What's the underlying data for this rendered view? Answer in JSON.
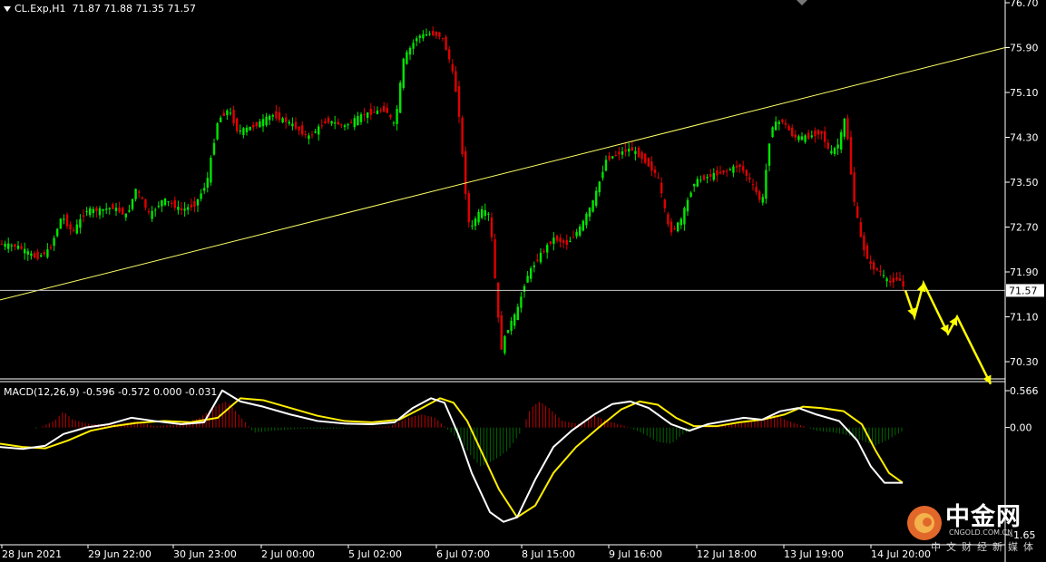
{
  "header": {
    "symbol": "CL.Exp,H1",
    "ohlc": "71.87 71.88 71.35 71.57",
    "macd_label": "MACD(12,26,9) -0.596 -0.572 0.000 -0.031"
  },
  "watermark": {
    "name": "中金网",
    "url": "CNGOLD.COM.CN",
    "tagline": "中文财经新媒体"
  },
  "colors": {
    "bull": "#00e600",
    "bear": "#e00000",
    "trendline": "#ffff66",
    "arrow": "#ffff00",
    "macd_line": "#ffffff",
    "signal_line": "#ffee00",
    "hist_pos": "#c00000",
    "hist_neg": "#006600"
  },
  "chart_data": [
    {
      "type": "candlestick",
      "timeframe": "H1",
      "y_ticks": [
        "76.70",
        "75.90",
        "75.10",
        "74.30",
        "73.50",
        "72.70",
        "71.90",
        "71.10",
        "70.30"
      ],
      "ylim": [
        70.0,
        76.7
      ],
      "current_price": "71.57",
      "x_ticks": [
        "28 Jun 2021",
        "29 Jun 22:00",
        "30 Jun 23:00",
        "2 Jul 00:00",
        "5 Jul 02:00",
        "6 Jul 07:00",
        "8 Jul 15:00",
        "9 Jul 16:00",
        "12 Jul 18:00",
        "13 Jul 19:00",
        "14 Jul 20:00"
      ],
      "close_path": [
        [
          0,
          72.4
        ],
        [
          20,
          72.35
        ],
        [
          40,
          72.15
        ],
        [
          55,
          72.3
        ],
        [
          68,
          72.9
        ],
        [
          80,
          72.6
        ],
        [
          95,
          73.0
        ],
        [
          110,
          73.0
        ],
        [
          125,
          73.05
        ],
        [
          140,
          72.9
        ],
        [
          150,
          73.4
        ],
        [
          165,
          72.9
        ],
        [
          180,
          73.2
        ],
        [
          200,
          73.0
        ],
        [
          215,
          73.1
        ],
        [
          228,
          73.5
        ],
        [
          240,
          74.6
        ],
        [
          252,
          74.8
        ],
        [
          262,
          74.4
        ],
        [
          280,
          74.5
        ],
        [
          300,
          74.7
        ],
        [
          320,
          74.55
        ],
        [
          340,
          74.3
        ],
        [
          360,
          74.6
        ],
        [
          380,
          74.5
        ],
        [
          400,
          74.7
        ],
        [
          425,
          74.8
        ],
        [
          435,
          74.5
        ],
        [
          445,
          75.7
        ],
        [
          460,
          76.1
        ],
        [
          475,
          76.15
        ],
        [
          487,
          76.1
        ],
        [
          497,
          75.6
        ],
        [
          505,
          74.9
        ],
        [
          512,
          73.5
        ],
        [
          518,
          72.6
        ],
        [
          525,
          72.9
        ],
        [
          532,
          73.0
        ],
        [
          540,
          72.9
        ],
        [
          547,
          71.5
        ],
        [
          552,
          70.5
        ],
        [
          560,
          70.9
        ],
        [
          570,
          71.2
        ],
        [
          580,
          71.8
        ],
        [
          595,
          72.2
        ],
        [
          610,
          72.5
        ],
        [
          625,
          72.4
        ],
        [
          640,
          72.7
        ],
        [
          655,
          73.2
        ],
        [
          668,
          73.9
        ],
        [
          680,
          74.0
        ],
        [
          695,
          74.1
        ],
        [
          710,
          73.9
        ],
        [
          725,
          73.6
        ],
        [
          738,
          72.6
        ],
        [
          750,
          72.8
        ],
        [
          765,
          73.5
        ],
        [
          780,
          73.6
        ],
        [
          800,
          73.7
        ],
        [
          815,
          73.8
        ],
        [
          828,
          73.5
        ],
        [
          840,
          73.1
        ],
        [
          850,
          74.5
        ],
        [
          862,
          74.6
        ],
        [
          875,
          74.3
        ],
        [
          890,
          74.3
        ],
        [
          905,
          74.4
        ],
        [
          915,
          74.0
        ],
        [
          925,
          74.2
        ],
        [
          932,
          74.7
        ],
        [
          940,
          73.3
        ],
        [
          950,
          72.4
        ],
        [
          960,
          72.0
        ],
        [
          970,
          71.9
        ],
        [
          980,
          71.7
        ],
        [
          990,
          71.8
        ],
        [
          998,
          71.57
        ]
      ],
      "trendline": {
        "from": [
          0,
          71.4
        ],
        "to": [
          1108,
          75.9
        ]
      },
      "horizontal_line": 71.57,
      "forecast_arrow": [
        [
          998,
          71.57
        ],
        [
          1008,
          71.1
        ],
        [
          1018,
          71.7
        ],
        [
          1045,
          70.8
        ],
        [
          1055,
          71.1
        ],
        [
          1092,
          69.9
        ]
      ]
    },
    {
      "type": "macd",
      "params": "12,26,9",
      "y_ticks": [
        "0.566",
        "0.00",
        "-1.65"
      ],
      "ylim": [
        -1.65,
        0.566
      ],
      "macd": [
        [
          0,
          -0.3
        ],
        [
          25,
          -0.33
        ],
        [
          50,
          -0.28
        ],
        [
          70,
          -0.1
        ],
        [
          95,
          0.0
        ],
        [
          120,
          0.05
        ],
        [
          145,
          0.15
        ],
        [
          170,
          0.1
        ],
        [
          200,
          0.05
        ],
        [
          225,
          0.08
        ],
        [
          245,
          0.57
        ],
        [
          265,
          0.4
        ],
        [
          290,
          0.32
        ],
        [
          320,
          0.2
        ],
        [
          350,
          0.1
        ],
        [
          380,
          0.06
        ],
        [
          410,
          0.05
        ],
        [
          435,
          0.08
        ],
        [
          455,
          0.3
        ],
        [
          475,
          0.45
        ],
        [
          490,
          0.38
        ],
        [
          505,
          -0.1
        ],
        [
          520,
          -0.7
        ],
        [
          540,
          -1.3
        ],
        [
          555,
          -1.45
        ],
        [
          570,
          -1.38
        ],
        [
          590,
          -0.8
        ],
        [
          610,
          -0.3
        ],
        [
          630,
          -0.05
        ],
        [
          655,
          0.2
        ],
        [
          675,
          0.36
        ],
        [
          695,
          0.4
        ],
        [
          715,
          0.3
        ],
        [
          740,
          0.05
        ],
        [
          760,
          -0.05
        ],
        [
          780,
          0.05
        ],
        [
          800,
          0.1
        ],
        [
          820,
          0.15
        ],
        [
          840,
          0.12
        ],
        [
          860,
          0.25
        ],
        [
          880,
          0.3
        ],
        [
          900,
          0.2
        ],
        [
          925,
          0.1
        ],
        [
          945,
          -0.2
        ],
        [
          960,
          -0.6
        ],
        [
          975,
          -0.85
        ],
        [
          995,
          -0.85
        ]
      ],
      "signal": [
        [
          0,
          -0.25
        ],
        [
          25,
          -0.3
        ],
        [
          50,
          -0.32
        ],
        [
          75,
          -0.2
        ],
        [
          100,
          -0.05
        ],
        [
          125,
          0.02
        ],
        [
          150,
          0.07
        ],
        [
          180,
          0.1
        ],
        [
          210,
          0.08
        ],
        [
          240,
          0.15
        ],
        [
          265,
          0.45
        ],
        [
          290,
          0.42
        ],
        [
          320,
          0.3
        ],
        [
          350,
          0.18
        ],
        [
          380,
          0.1
        ],
        [
          410,
          0.08
        ],
        [
          440,
          0.12
        ],
        [
          465,
          0.3
        ],
        [
          485,
          0.45
        ],
        [
          500,
          0.38
        ],
        [
          515,
          0.1
        ],
        [
          530,
          -0.35
        ],
        [
          550,
          -0.95
        ],
        [
          570,
          -1.38
        ],
        [
          590,
          -1.2
        ],
        [
          610,
          -0.7
        ],
        [
          635,
          -0.3
        ],
        [
          660,
          0.0
        ],
        [
          685,
          0.28
        ],
        [
          705,
          0.4
        ],
        [
          725,
          0.35
        ],
        [
          745,
          0.15
        ],
        [
          765,
          0.02
        ],
        [
          790,
          0.02
        ],
        [
          815,
          0.08
        ],
        [
          840,
          0.12
        ],
        [
          865,
          0.2
        ],
        [
          885,
          0.32
        ],
        [
          905,
          0.3
        ],
        [
          930,
          0.25
        ],
        [
          950,
          0.05
        ],
        [
          965,
          -0.35
        ],
        [
          980,
          -0.7
        ],
        [
          995,
          -0.85
        ]
      ],
      "histogram": [
        [
          40,
          -0.02
        ],
        [
          60,
          0.1
        ],
        [
          70,
          0.25
        ],
        [
          80,
          0.12
        ],
        [
          100,
          0.05
        ],
        [
          130,
          0.05
        ],
        [
          150,
          0.1
        ],
        [
          170,
          0.02
        ],
        [
          200,
          0.05
        ],
        [
          220,
          0.15
        ],
        [
          240,
          0.35
        ],
        [
          250,
          0.4
        ],
        [
          260,
          0.25
        ],
        [
          280,
          -0.08
        ],
        [
          300,
          -0.05
        ],
        [
          330,
          -0.02
        ],
        [
          370,
          -0.02
        ],
        [
          400,
          0.0
        ],
        [
          430,
          0.02
        ],
        [
          450,
          0.15
        ],
        [
          465,
          0.2
        ],
        [
          480,
          0.15
        ],
        [
          495,
          -0.05
        ],
        [
          510,
          -0.25
        ],
        [
          520,
          -0.45
        ],
        [
          530,
          -0.6
        ],
        [
          545,
          -0.5
        ],
        [
          560,
          -0.35
        ],
        [
          575,
          -0.05
        ],
        [
          585,
          0.3
        ],
        [
          595,
          0.4
        ],
        [
          605,
          0.3
        ],
        [
          620,
          0.1
        ],
        [
          640,
          0.05
        ],
        [
          655,
          0.18
        ],
        [
          670,
          0.1
        ],
        [
          690,
          0.02
        ],
        [
          710,
          -0.1
        ],
        [
          725,
          -0.22
        ],
        [
          740,
          -0.25
        ],
        [
          755,
          -0.08
        ],
        [
          780,
          0.02
        ],
        [
          800,
          0.06
        ],
        [
          820,
          0.08
        ],
        [
          840,
          0.1
        ],
        [
          855,
          0.2
        ],
        [
          865,
          0.12
        ],
        [
          880,
          0.05
        ],
        [
          900,
          -0.05
        ],
        [
          920,
          -0.08
        ],
        [
          935,
          -0.12
        ],
        [
          950,
          -0.2
        ],
        [
          965,
          -0.28
        ],
        [
          980,
          -0.18
        ],
        [
          995,
          -0.05
        ]
      ]
    }
  ]
}
